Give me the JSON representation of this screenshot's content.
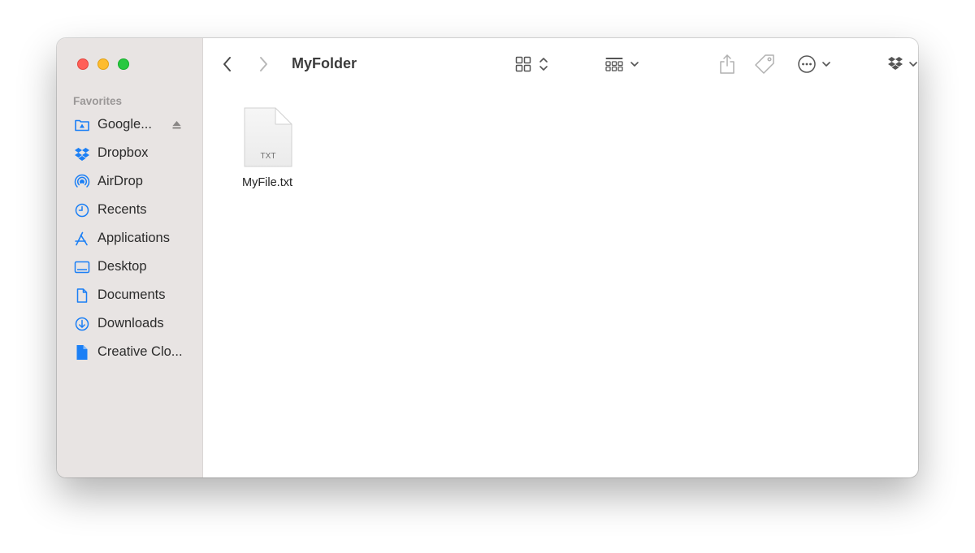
{
  "window": {
    "folder_title": "MyFolder"
  },
  "sidebar": {
    "section_header": "Favorites",
    "items": [
      {
        "label": "Google...",
        "icon": "google-drive-icon"
      },
      {
        "label": "Dropbox",
        "icon": "dropbox-icon"
      },
      {
        "label": "AirDrop",
        "icon": "airdrop-icon"
      },
      {
        "label": "Recents",
        "icon": "clock-icon"
      },
      {
        "label": "Applications",
        "icon": "applications-icon"
      },
      {
        "label": "Desktop",
        "icon": "desktop-icon"
      },
      {
        "label": "Documents",
        "icon": "document-icon"
      },
      {
        "label": "Downloads",
        "icon": "download-icon"
      },
      {
        "label": "Creative Clo...",
        "icon": "creative-cloud-file-icon"
      }
    ]
  },
  "toolbar": {
    "icons": [
      "back-icon",
      "forward-icon",
      "icon-view-icon",
      "group-icon",
      "share-icon",
      "tag-icon",
      "more-actions-icon",
      "dropbox-icon",
      "search-icon"
    ]
  },
  "content": {
    "files": [
      {
        "name": "MyFile.txt",
        "ext": "TXT"
      }
    ]
  },
  "colors": {
    "sidebar_bg": "#e8e4e3",
    "accent": "#1b7ff5",
    "traffic_red": "#ff5f57",
    "traffic_yellow": "#febc2e",
    "traffic_green": "#28c840"
  }
}
